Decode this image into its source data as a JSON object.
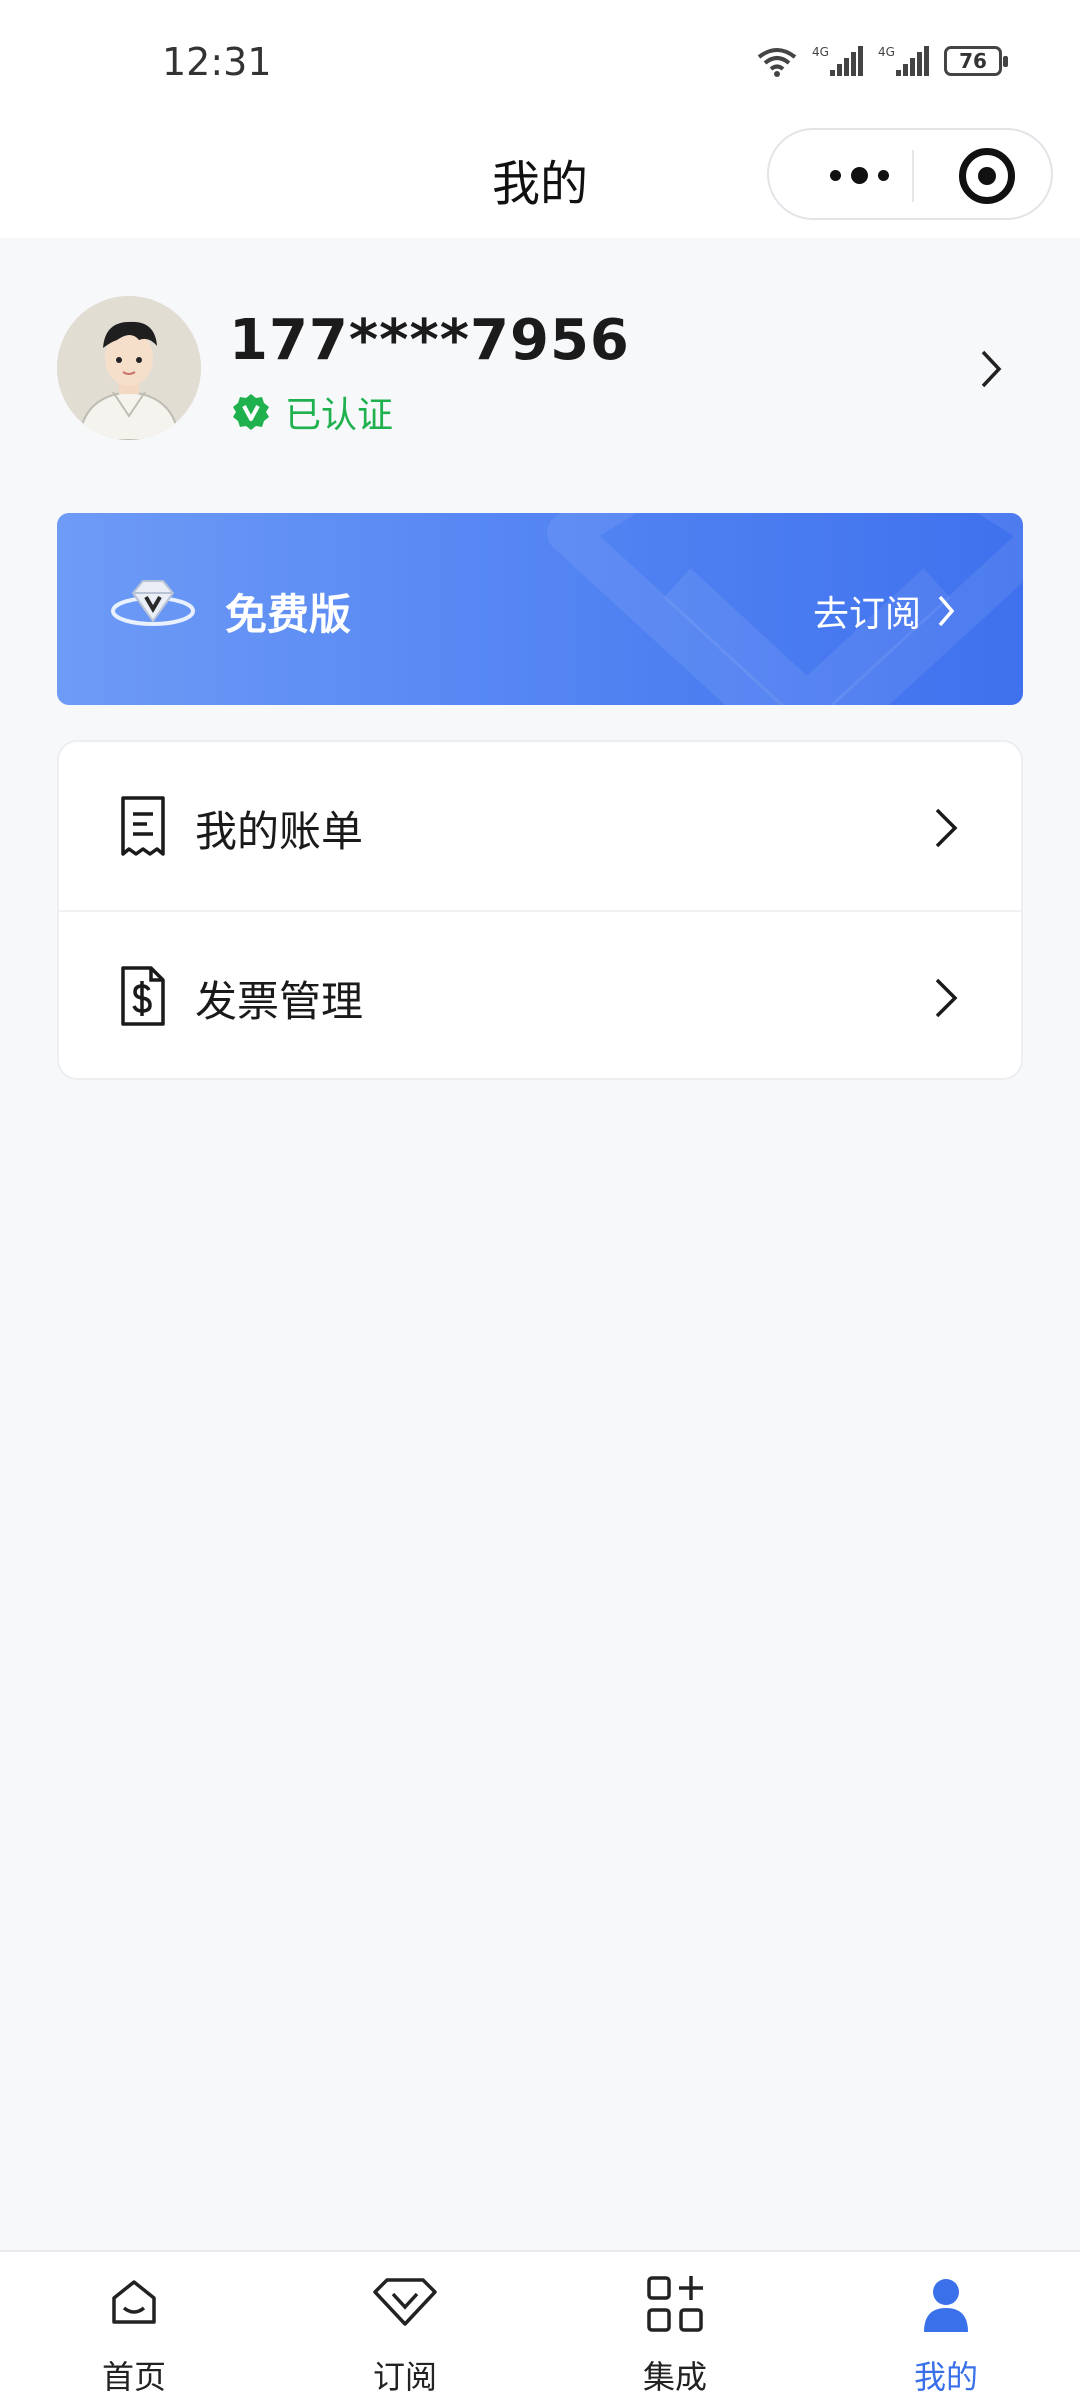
{
  "status_bar": {
    "time": "12:31",
    "battery": "76",
    "network_1": "4G",
    "network_2": "4G"
  },
  "nav": {
    "title": "我的"
  },
  "profile": {
    "phone": "177****7956",
    "verified_label": "已认证"
  },
  "vip": {
    "plan": "免费版",
    "action": "去订阅"
  },
  "menu": [
    {
      "label": "我的账单",
      "icon": "receipt-icon"
    },
    {
      "label": "发票管理",
      "icon": "invoice-dollar-icon"
    }
  ],
  "tabs": [
    {
      "label": "首页",
      "icon": "home-icon",
      "active": false
    },
    {
      "label": "订阅",
      "icon": "diamond-icon",
      "active": false
    },
    {
      "label": "集成",
      "icon": "grid-plus-icon",
      "active": false
    },
    {
      "label": "我的",
      "icon": "user-icon",
      "active": true
    }
  ],
  "colors": {
    "accent": "#3a70ea",
    "verified": "#1fb14e",
    "card_start": "#6e9bf6",
    "card_end": "#3f71ee"
  }
}
